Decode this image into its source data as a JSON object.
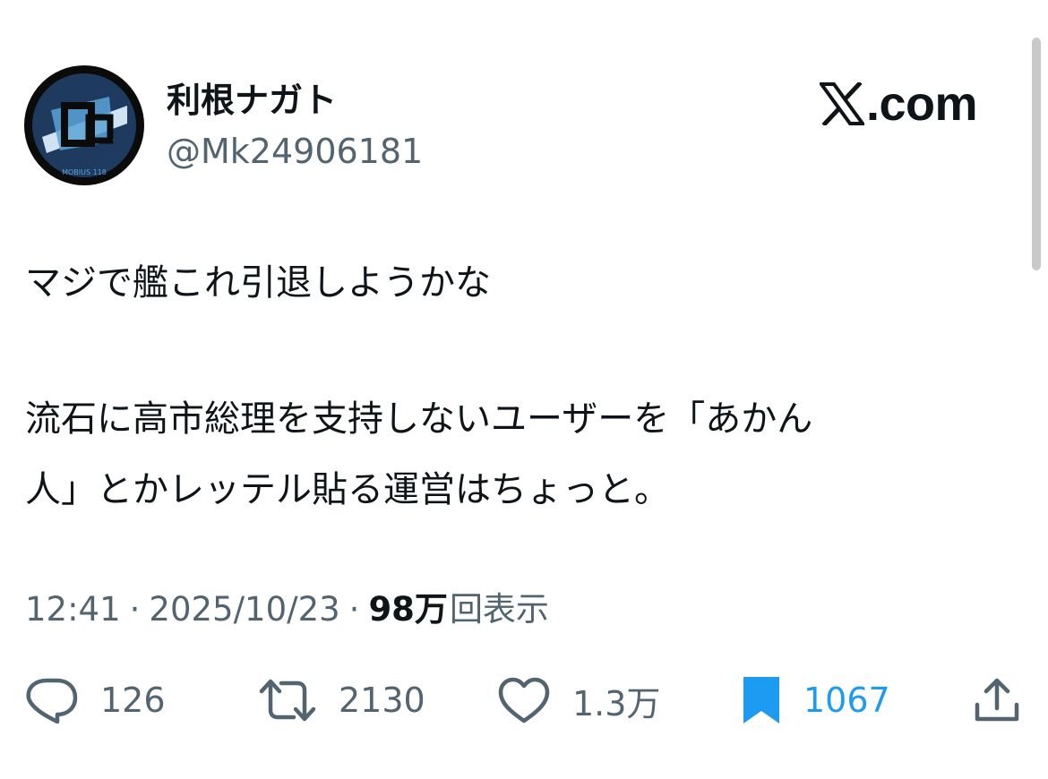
{
  "author": {
    "display_name": "利根ナガト",
    "handle": "@Mk24906181",
    "avatar_badge_text": "MOBIUS 118"
  },
  "site": {
    "domain_text": ".com",
    "logo_icon": "x-logo-icon"
  },
  "tweet": {
    "lines": [
      "マジで艦これ引退しようかな",
      "流石に高市総理を支持しないユーザーを「あかん",
      "人」とかレッテル貼る運営はちょっと。"
    ]
  },
  "meta": {
    "time": "12:41",
    "separator": "·",
    "date": "2025/10/23",
    "views_count": "98万",
    "views_label": "回表示"
  },
  "actions": {
    "replies": {
      "icon": "reply-icon",
      "count": "126"
    },
    "reposts": {
      "icon": "repost-icon",
      "count": "2130"
    },
    "likes": {
      "icon": "heart-icon",
      "count": "1.3万"
    },
    "bookmarks": {
      "icon": "bookmark-icon",
      "count": "1067",
      "active": true
    },
    "share": {
      "icon": "share-icon"
    }
  },
  "colors": {
    "text_primary": "#0f1419",
    "text_secondary": "#536471",
    "accent_blue": "#1d9bf0"
  }
}
